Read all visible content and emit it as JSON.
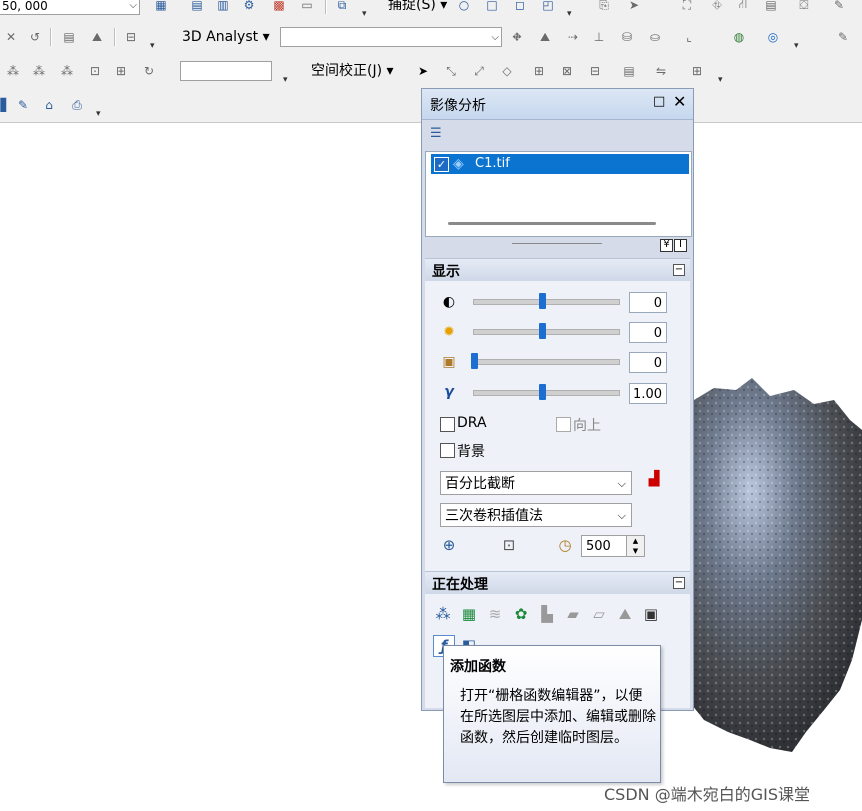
{
  "toolbar": {
    "scale_value": "50, 000",
    "snapping_label": "捕捉(S)",
    "analyst_label": "3D Analyst",
    "georef_label": "空间校正(J)",
    "grip": "▾"
  },
  "panel": {
    "title": "影像分析",
    "maximize": "□",
    "close": "✕",
    "list_icon": "☰",
    "layer": {
      "checked": true,
      "check_mark": "✓",
      "name": "C1.tif"
    },
    "mini_buttons": [
      "¥",
      "I"
    ],
    "display": {
      "header": "显示",
      "collapse": "−",
      "sliders": [
        {
          "icon": "contrast-icon",
          "glyph": "◐",
          "value": "0",
          "fraction": 0.5
        },
        {
          "icon": "brightness-icon",
          "glyph": "✹",
          "value": "0",
          "fraction": 0.5
        },
        {
          "icon": "transparency-icon",
          "glyph": "▣",
          "value": "0",
          "fraction": 0.0
        },
        {
          "icon": "gamma-icon",
          "glyph": "γ",
          "value": "1.00",
          "fraction": 0.5
        }
      ],
      "dra_label": "DRA",
      "north_up_label": "向上",
      "background_label": "背景",
      "stretch": "百分比截断",
      "resample": "三次卷积插值法",
      "zoom_value": "500",
      "select_arrow": "⌵"
    },
    "processing": {
      "header": "正在处理",
      "collapse": "−"
    }
  },
  "tooltip": {
    "title": "添加函数",
    "body": "打开“栅格函数编辑器”，以便在所选图层中添加、编辑或删除函数，然后创建临时图层。"
  },
  "watermark": "CSDN @端木宛白的GIS课堂",
  "colors": {
    "selection": "#0b74d1",
    "slider_thumb": "#1c6fd1",
    "panel_bg": "#d6dbe9"
  }
}
